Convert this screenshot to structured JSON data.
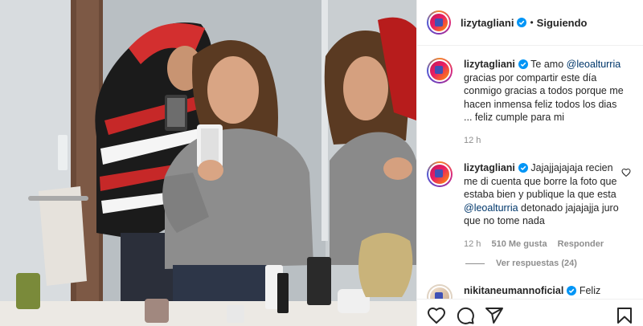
{
  "header": {
    "username": "lizytagliani",
    "dot": "•",
    "follow_label": "Siguiendo",
    "icons": [
      "avatar",
      "verified-badge-icon"
    ]
  },
  "caption": {
    "username": "lizytagliani",
    "text_before": "Te amo ",
    "mention": "@leoalturria",
    "text_after": " gracias por compartir este día conmigo gracias a todos porque me hacen inmensa feliz todos los dias ... feliz cumple para mi",
    "time": "12 h"
  },
  "comment": {
    "username": "lizytagliani",
    "text_before": "Jajajjajajaja recien me di cuenta que borre la foto que estaba bien y publique la que esta ",
    "mention": "@leoalturria",
    "text_after": " detonado jajajajja juro que no tome nada",
    "time": "12 h",
    "likes": "510 Me gusta",
    "reply_label": "Responder",
    "view_replies": "Ver respuestas (24)"
  },
  "next_comment": {
    "username": "nikitaneumannoficial",
    "text": "Feliz"
  },
  "action_icons": [
    "heart-icon",
    "comment-icon",
    "share-icon",
    "bookmark-icon"
  ],
  "colors": {
    "verified": "#0095f6",
    "mention": "#00376b",
    "muted": "#8e8e8e",
    "text": "#262626"
  }
}
